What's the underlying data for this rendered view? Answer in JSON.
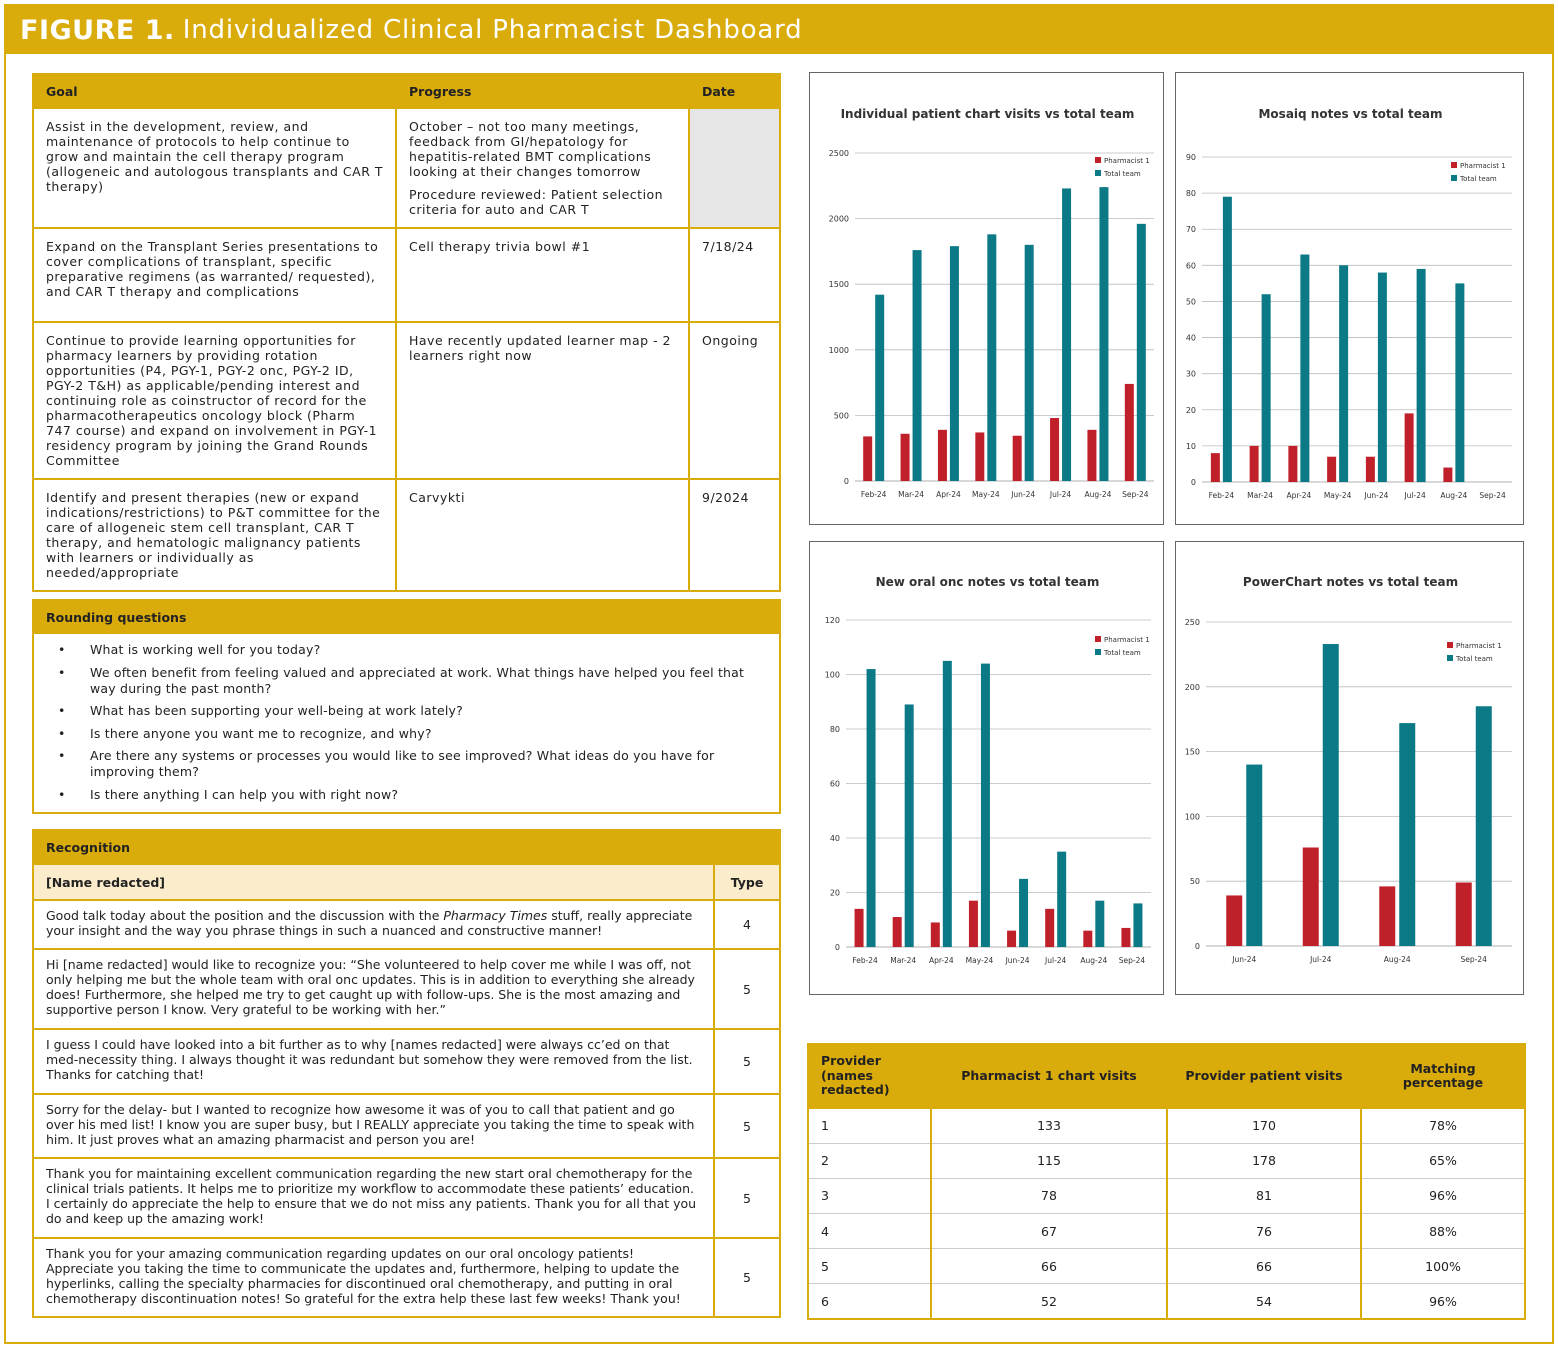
{
  "figure": {
    "label": "FIGURE 1.",
    "title": "Individualized Clinical Pharmacist Dashboard"
  },
  "goals_table": {
    "headers": [
      "Goal",
      "Progress",
      "Date"
    ],
    "rows": [
      {
        "goal": "Assist in the development, review, and maintenance of protocols to help continue to grow and maintain the cell therapy program (allogeneic and autologous transplants and CAR T therapy)",
        "progress": "October – not too many meetings, feedback from GI/hepatology for hepatitis-related BMT complications looking at their changes tomorrow",
        "progress2": "Procedure reviewed: Patient selection criteria for auto and CAR T",
        "date": ""
      },
      {
        "goal": "Expand on the Transplant Series presentations to cover complications of transplant, specific preparative regimens (as warranted/ requested), and CAR T therapy and complications",
        "progress": "Cell therapy trivia bowl #1",
        "progress2": "",
        "date": "7/18/24"
      },
      {
        "goal": "Continue to provide learning opportunities for pharmacy learners by providing rotation opportunities (P4, PGY-1, PGY-2 onc, PGY-2 ID, PGY-2 T&H) as applicable/pending interest and continuing role as coinstructor of record for the pharmacotherapeutics oncology block (Pharm 747 course) and expand on involvement in PGY-1 residency program by joining the Grand Rounds Committee",
        "progress": "Have recently updated learner map - 2 learners right now",
        "progress2": "",
        "date": "Ongoing"
      },
      {
        "goal": "Identify and present therapies (new or expand indications/restrictions) to P&T committee for the care of allogeneic stem cell transplant, CAR T therapy, and hematologic malignancy patients with learners or individually as needed/appropriate",
        "progress": "Carvykti",
        "progress2": "",
        "date": "9/2024"
      }
    ]
  },
  "rounding": {
    "title": "Rounding questions",
    "items": [
      "What is working well for you today?",
      "We often benefit from feeling valued and appreciated at work. What things have helped you feel that way during the past month?",
      "What has been supporting your well-being at work lately?",
      "Is there anyone you want me to recognize, and why?",
      "Are there any systems or processes you would like to see improved? What ideas do you have for improving them?",
      "Is there anything I can help you with right now?"
    ]
  },
  "recognition": {
    "title": "Recognition",
    "name_header": "[Name redacted]",
    "type_header": "Type",
    "rows": [
      {
        "pre": "Good talk today about the position and the discussion with the ",
        "em": "Pharmacy Times",
        "post": " stuff, really appreciate your insight and the way you phrase things in such a nuanced and constructive manner!",
        "type": "4"
      },
      {
        "pre": "Hi [name redacted] would like to recognize you: “She volunteered to help cover me while I was off, not only helping me but the whole team with oral onc updates. This is in addition to everything she already does! Furthermore, she helped me try to get caught up with follow-ups. She is the most amazing and supportive person I know. Very grateful to be working with her.”",
        "em": "",
        "post": "",
        "type": "5"
      },
      {
        "pre": "I guess I could have looked into a bit further as to why [names redacted] were always cc’ed on that med-necessity thing. I always thought it was redundant but somehow they were removed from the list. Thanks for catching that!",
        "em": "",
        "post": "",
        "type": "5"
      },
      {
        "pre": "Sorry for the delay- but I wanted to recognize how awesome it was of you to call that patient and go over his med list! I know you are super busy, but I REALLY appreciate you taking the time to speak with him. It just proves what an amazing pharmacist and person you are!",
        "em": "",
        "post": "",
        "type": "5"
      },
      {
        "pre": "Thank you for maintaining excellent communication regarding the new start oral chemotherapy for the clinical trials patients. It helps me to prioritize my workflow to accommodate these patients’ education. I certainly do appreciate the help to ensure that we do not miss any patients. Thank you for all that you do and keep up the amazing work!",
        "em": "",
        "post": "",
        "type": "5"
      },
      {
        "pre": "Thank you for your amazing communication regarding updates on our oral oncology patients! Appreciate you taking the time to communicate the updates and, furthermore, helping to update the hyperlinks, calling the specialty pharmacies for discontinued oral chemotherapy, and putting in oral chemotherapy discontinuation notes! So grateful for the extra help these last few weeks! Thank you!",
        "em": "",
        "post": "",
        "type": "5"
      }
    ]
  },
  "colors": {
    "gold": "#d9ab0b",
    "pharmacist": "#c0202a",
    "team": "#0b7a86"
  },
  "chart_data": [
    {
      "type": "bar",
      "title": "Individual patient chart visits vs total team",
      "categories": [
        "Feb-24",
        "Mar-24",
        "Apr-24",
        "May-24",
        "Jun-24",
        "Jul-24",
        "Aug-24",
        "Sep-24"
      ],
      "series": [
        {
          "name": "Pharmacist 1",
          "values": [
            340,
            360,
            390,
            370,
            345,
            480,
            390,
            740
          ]
        },
        {
          "name": "Total team",
          "values": [
            1420,
            1760,
            1790,
            1880,
            1800,
            2230,
            2240,
            1960
          ]
        }
      ],
      "yticks": [
        0,
        500,
        1000,
        1500,
        2000,
        2500
      ],
      "ylim": [
        0,
        2500
      ],
      "legend": "top-right"
    },
    {
      "type": "bar",
      "title": "Mosaiq notes vs total team",
      "categories": [
        "Feb-24",
        "Mar-24",
        "Apr-24",
        "May-24",
        "Jun-24",
        "Jul-24",
        "Aug-24",
        "Sep-24"
      ],
      "series": [
        {
          "name": "Pharmacist 1",
          "values": [
            8,
            10,
            10,
            7,
            7,
            19,
            4,
            null
          ]
        },
        {
          "name": "Total team",
          "values": [
            79,
            52,
            63,
            60,
            58,
            59,
            55,
            null
          ]
        }
      ],
      "yticks": [
        0,
        10,
        20,
        30,
        40,
        50,
        60,
        70,
        80,
        90
      ],
      "ylim": [
        0,
        90
      ],
      "legend": "top-right"
    },
    {
      "type": "bar",
      "title": "New oral onc notes vs total team",
      "categories": [
        "Feb-24",
        "Mar-24",
        "Apr-24",
        "May-24",
        "Jun-24",
        "Jul-24",
        "Aug-24",
        "Sep-24"
      ],
      "series": [
        {
          "name": "Pharmacist 1",
          "values": [
            14,
            11,
            9,
            17,
            6,
            14,
            6,
            7
          ]
        },
        {
          "name": "Total team",
          "values": [
            102,
            89,
            105,
            104,
            25,
            35,
            17,
            16
          ]
        }
      ],
      "yticks": [
        0,
        20,
        40,
        60,
        80,
        100,
        120
      ],
      "ylim": [
        0,
        120
      ],
      "legend": "top-right"
    },
    {
      "type": "bar",
      "title": "PowerChart notes vs total team",
      "categories": [
        "Jun-24",
        "Jul-24",
        "Aug-24",
        "Sep-24"
      ],
      "series": [
        {
          "name": "Pharmacist 1",
          "values": [
            39,
            76,
            46,
            49
          ]
        },
        {
          "name": "Total team",
          "values": [
            140,
            233,
            172,
            185
          ]
        }
      ],
      "yticks": [
        0,
        50,
        100,
        150,
        200,
        250
      ],
      "ylim": [
        0,
        250
      ],
      "legend": "top-right"
    }
  ],
  "matching_table": {
    "headers": [
      "Provider (names redacted)",
      "Pharmacist 1 chart visits",
      "Provider patient visits",
      "Matching percentage"
    ],
    "rows": [
      [
        "1",
        "133",
        "170",
        "78%"
      ],
      [
        "2",
        "115",
        "178",
        "65%"
      ],
      [
        "3",
        "78",
        "81",
        "96%"
      ],
      [
        "4",
        "67",
        "76",
        "88%"
      ],
      [
        "5",
        "66",
        "66",
        "100%"
      ],
      [
        "6",
        "52",
        "54",
        "96%"
      ]
    ]
  }
}
